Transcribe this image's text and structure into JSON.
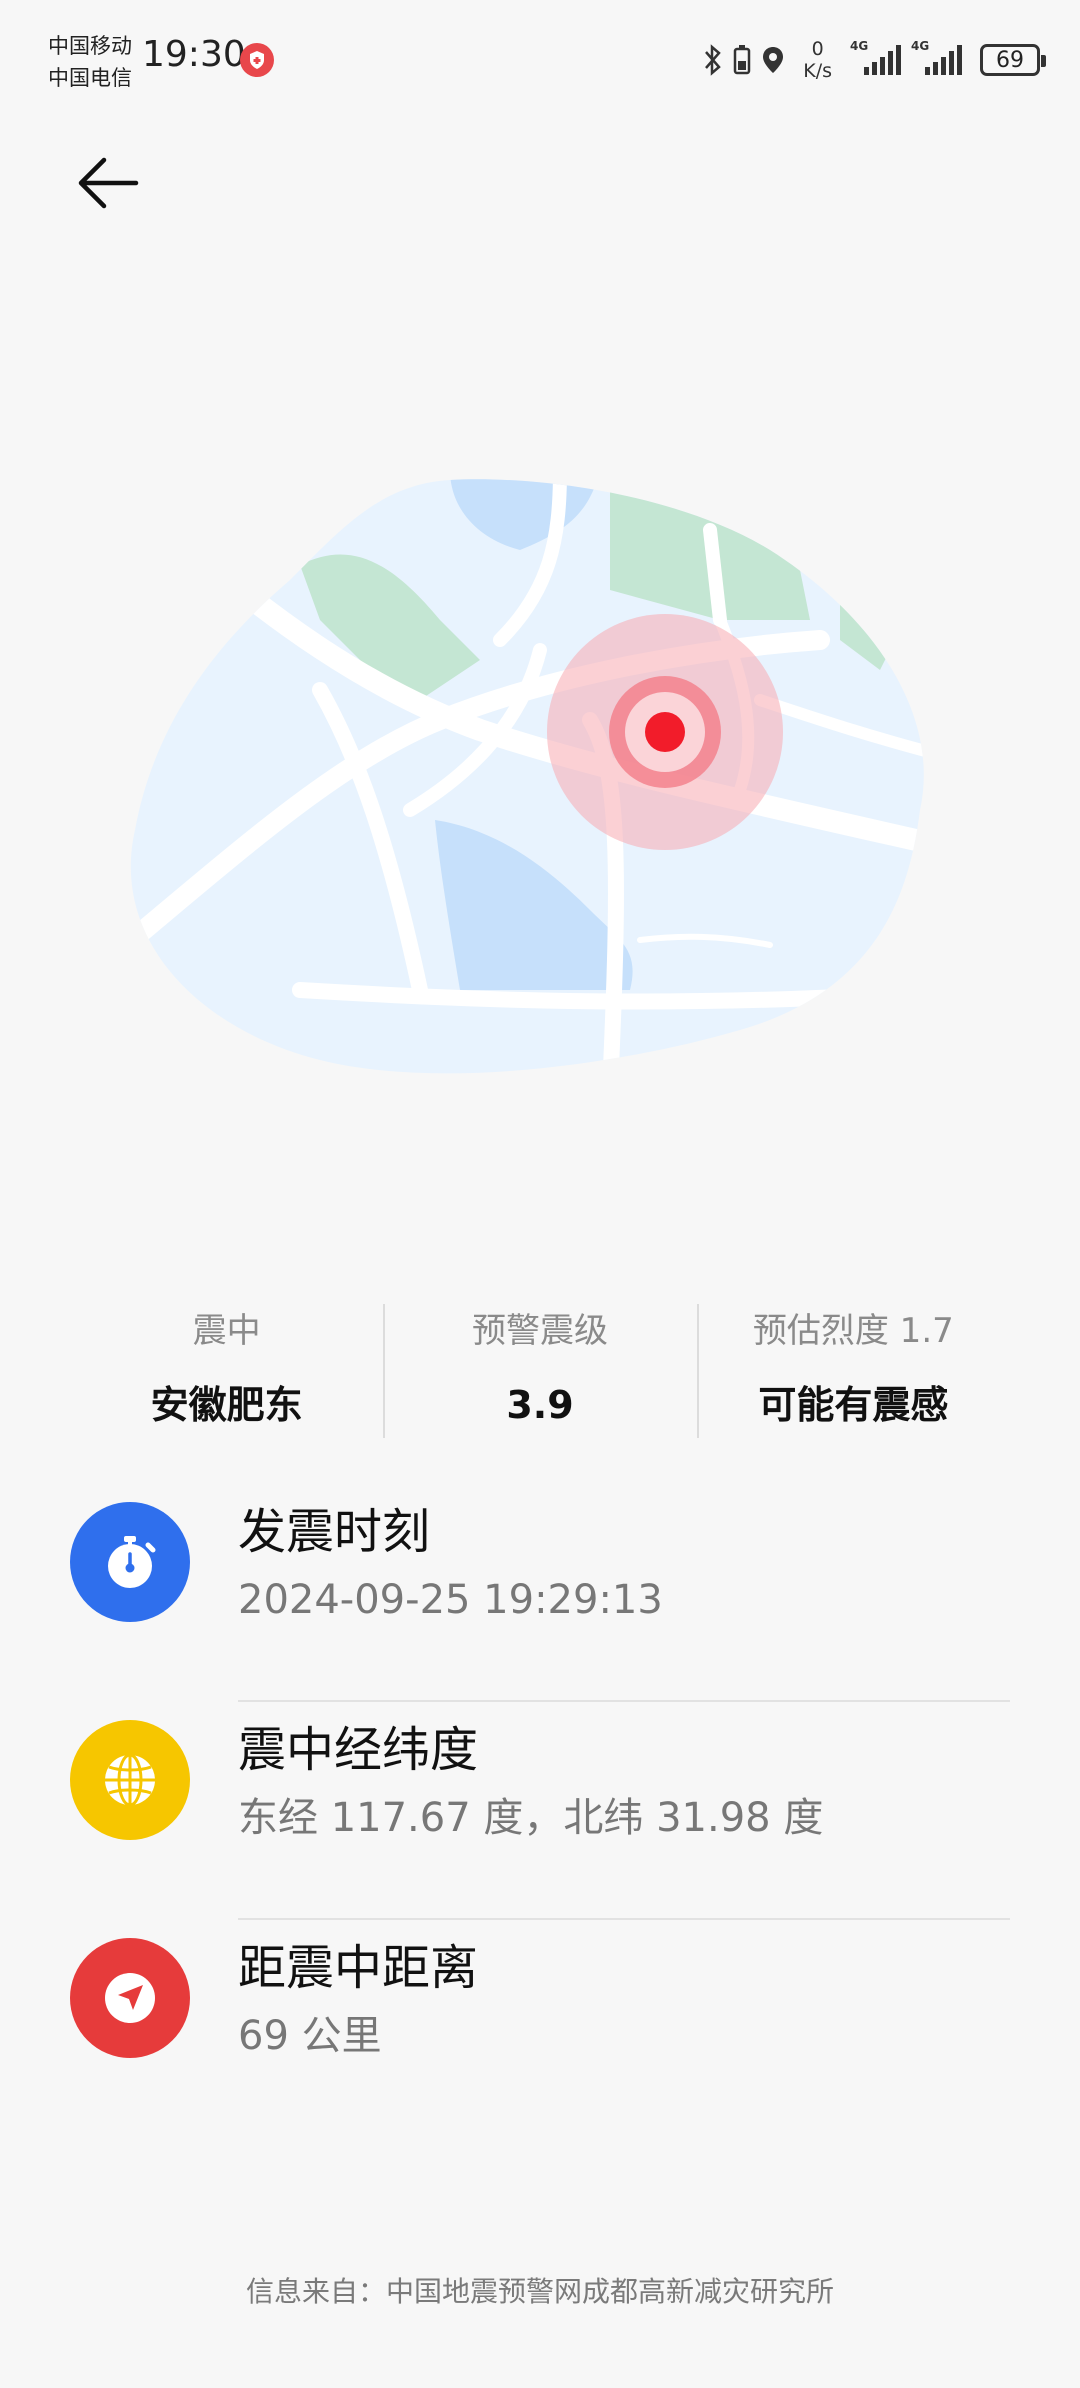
{
  "status_bar": {
    "carrier_1": "中国移动",
    "carrier_2": "中国电信",
    "time": "19:30",
    "net_speed_value": "0",
    "net_speed_unit": "K/s",
    "signal_1_label": "4G",
    "signal_2_label": "4G",
    "battery_level": "69"
  },
  "nav": {
    "back_icon": "arrow-left-icon"
  },
  "map": {
    "icon": "epicenter-map-illustration",
    "colors": {
      "land": "#e8f3fe",
      "water": "#c6e0fb",
      "park": "#c4e6d3",
      "road": "#ffffff",
      "marker": "#f21c2a"
    }
  },
  "summary": [
    {
      "label": "震中",
      "value": "安徽肥东"
    },
    {
      "label": "预警震级",
      "value": "3.9"
    },
    {
      "label": "预估烈度 1.7",
      "value": "可能有震感"
    }
  ],
  "details": [
    {
      "icon": "stopwatch-icon",
      "color": "#2f6fed",
      "title": "发震时刻",
      "value": "2024-09-25 19:29:13"
    },
    {
      "icon": "globe-icon",
      "color": "#f6c600",
      "title": "震中经纬度",
      "value": "东经 117.67 度，北纬 31.98 度"
    },
    {
      "icon": "navigation-arrow-icon",
      "color": "#e63b3b",
      "title": "距震中距离",
      "value": "69 公里"
    }
  ],
  "footer": {
    "source": "信息来自：中国地震预警网成都高新减灾研究所"
  }
}
